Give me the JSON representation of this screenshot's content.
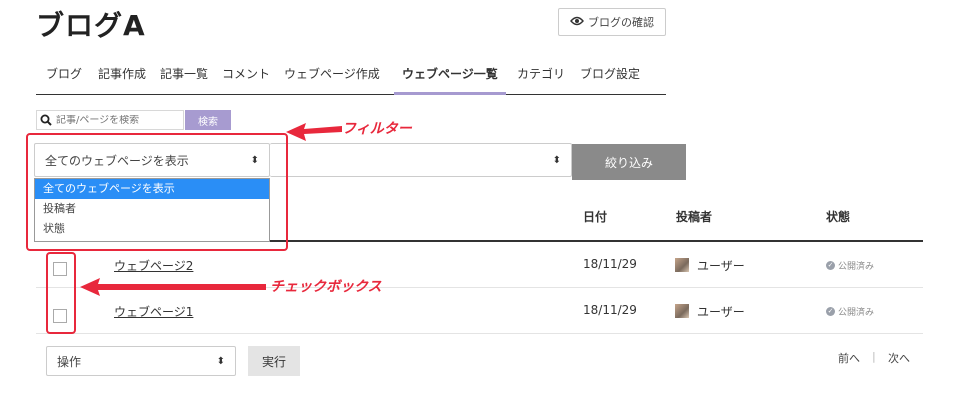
{
  "header": {
    "title": "ブログA",
    "confirm_label": "ブログの確認"
  },
  "tabs": [
    {
      "label": "ブログ"
    },
    {
      "label": "記事作成"
    },
    {
      "label": "記事一覧"
    },
    {
      "label": "コメント"
    },
    {
      "label": "ウェブページ作成"
    },
    {
      "label": "ウェブページ一覧",
      "active": true
    },
    {
      "label": "カテゴリ"
    },
    {
      "label": "ブログ設定"
    }
  ],
  "search": {
    "placeholder": "記事/ページを検索",
    "button_label": "検索"
  },
  "filter": {
    "selected": "全てのウェブページを表示",
    "options": [
      "全てのウェブページを表示",
      "投稿者",
      "状態"
    ],
    "button_label": "絞り込み"
  },
  "table": {
    "columns": {
      "date": "日付",
      "author": "投稿者",
      "status": "状態"
    },
    "rows": [
      {
        "title": "ウェブページ2",
        "date": "18/11/29",
        "author": "ユーザー",
        "status": "公開済み"
      },
      {
        "title": "ウェブページ1",
        "date": "18/11/29",
        "author": "ユーザー",
        "status": "公開済み"
      }
    ]
  },
  "bulk": {
    "action_placeholder": "操作",
    "run_label": "実行"
  },
  "pager": {
    "prev": "前へ",
    "separator": "|",
    "next": "次へ"
  },
  "annotations": {
    "filter": "フィルター",
    "checkbox": "チェックボックス",
    "accent_color": "#e8283c"
  }
}
